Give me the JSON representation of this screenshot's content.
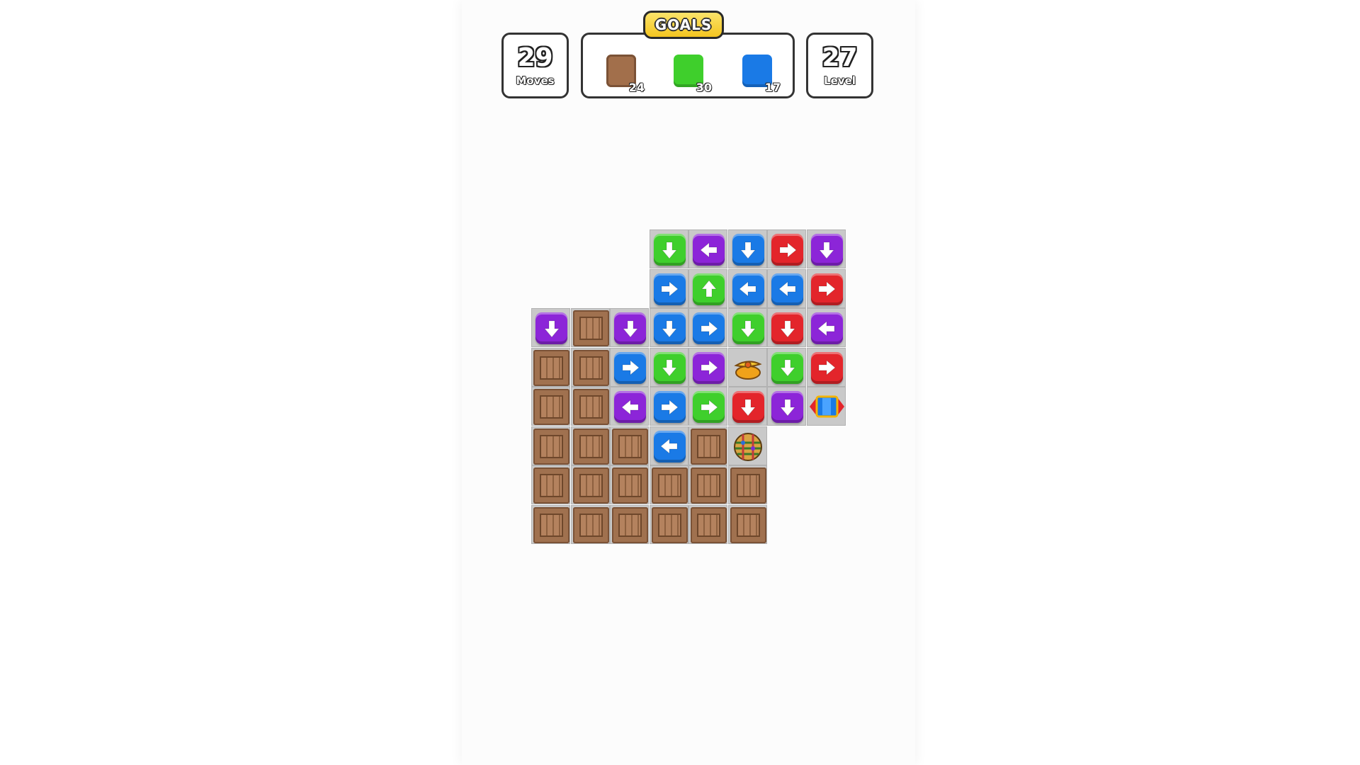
{
  "hud": {
    "goals_label": "GOALS",
    "moves": {
      "value": "29",
      "label": "Moves"
    },
    "level": {
      "value": "27",
      "label": "Level"
    },
    "goals": [
      {
        "type": "crate",
        "count": "24",
        "color": "#a26f4b"
      },
      {
        "type": "green",
        "count": "30",
        "color": "#3fcf2c"
      },
      {
        "type": "blue",
        "count": "17",
        "color": "#1a7ae6"
      }
    ]
  },
  "colors": {
    "green": "#3fcf2c",
    "purple": "#8c25d8",
    "blue": "#1a7ae6",
    "red": "#e3252b",
    "crate": "#a0714f",
    "cell": "#c9c9c9",
    "background": "#fcfcfc"
  },
  "board": {
    "columns": 8,
    "rows": 8,
    "layout": [
      [
        null,
        null,
        null,
        "green-down",
        "purple-left",
        "blue-down",
        "red-right",
        "purple-down"
      ],
      [
        null,
        null,
        null,
        "blue-right",
        "green-up",
        "blue-left",
        "blue-left",
        "red-right"
      ],
      [
        "purple-down",
        "crate",
        "purple-down",
        "blue-down",
        "blue-right",
        "green-down",
        "red-down",
        "purple-left"
      ],
      [
        "crate",
        "crate",
        "blue-right",
        "green-down",
        "purple-right",
        "propeller",
        "green-down",
        "red-right"
      ],
      [
        "crate",
        "crate",
        "purple-left",
        "blue-right",
        "green-right",
        "red-down",
        "purple-down",
        "rocket"
      ],
      [
        "crate",
        "crate",
        "crate",
        "blue-left",
        "crate",
        "disco-ball",
        null,
        null
      ],
      [
        "crate",
        "crate",
        "crate",
        "crate",
        "crate",
        "crate",
        null,
        null
      ],
      [
        "crate",
        "crate",
        "crate",
        "crate",
        "crate",
        "crate",
        null,
        null
      ]
    ]
  }
}
